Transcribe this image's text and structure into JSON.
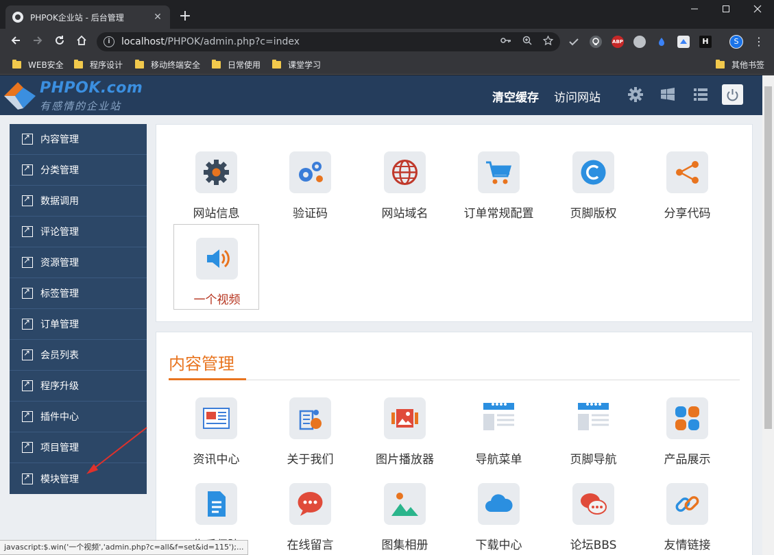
{
  "browser": {
    "tab_title": "PHPOK企业站 - 后台管理",
    "tab_close": "✕",
    "new_tab": "+",
    "url_host": "localhost",
    "url_path": "/PHPOK/admin.php?c=index",
    "profile_initial": "S",
    "ext_abp": "ABP",
    "ext_h": "H",
    "bookmarks": [
      "WEB安全",
      "程序设计",
      "移动终端安全",
      "日常使用",
      "课堂学习"
    ],
    "other_bookmarks": "其他书签",
    "status_text": "javascript:$.win('一个视频','admin.php?c=all&f=set&id=115');..."
  },
  "header": {
    "brand": "PHPOK.com",
    "slogan": "有感情的企业站",
    "clear_cache": "清空缓存",
    "visit_site": "访问网站"
  },
  "sidebar": {
    "items": [
      "内容管理",
      "分类管理",
      "数据调用",
      "评论管理",
      "资源管理",
      "标签管理",
      "订单管理",
      "会员列表",
      "程序升级",
      "插件中心",
      "项目管理",
      "模块管理"
    ]
  },
  "settings_panel": {
    "tiles": [
      "网站信息",
      "验证码",
      "网站域名",
      "订单常规配置",
      "页脚版权",
      "分享代码",
      "一个视频"
    ]
  },
  "content_panel": {
    "title": "内容管理",
    "tiles": [
      "资讯中心",
      "关于我们",
      "图片播放器",
      "导航菜单",
      "页脚导航",
      "产品展示",
      "售后保障",
      "在线留言",
      "图集相册",
      "下载中心",
      "论坛BBS",
      "友情链接"
    ]
  },
  "colors": {
    "header_bg": "#253d5c",
    "sidebar_bg": "#2c4767",
    "accent_orange": "#e8741f",
    "selected_label": "#b5321c"
  }
}
